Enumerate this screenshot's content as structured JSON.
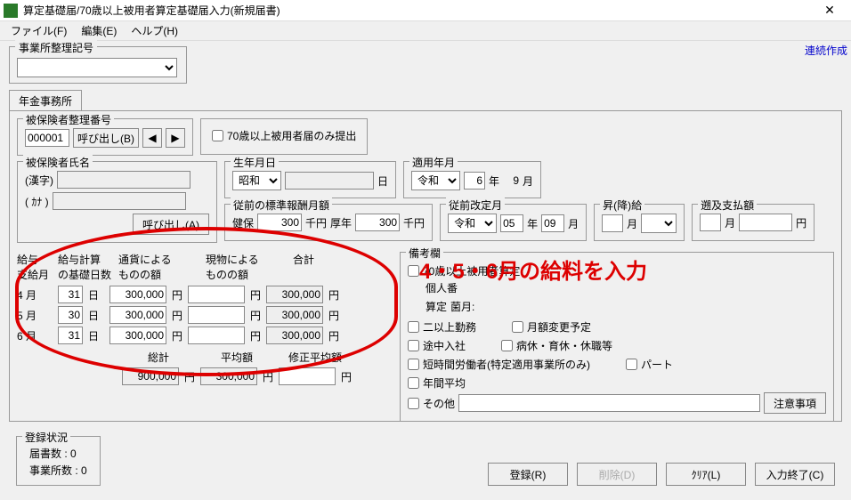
{
  "window": {
    "title": "算定基礎届/70歳以上被用者算定基礎届入力(新規届書)"
  },
  "menu": {
    "file": "ファイル(F)",
    "edit": "編集(E)",
    "help": "ヘルプ(H)"
  },
  "link": {
    "renzoku": "連続作成"
  },
  "office": {
    "label": "事業所整理記号"
  },
  "tab": {
    "nenkin": "年金事務所"
  },
  "hiho_no": {
    "label": "被保険者整理番号",
    "value": "000001",
    "call": "呼び出し(B)",
    "over70": "70歳以上被用者届のみ提出"
  },
  "name": {
    "label": "被保険者氏名",
    "kanji": "(漢字)",
    "kana": "( ｶﾅ )",
    "call": "呼び出し(A)"
  },
  "birth": {
    "label": "生年月日",
    "era": "昭和",
    "day_unit": "日"
  },
  "apply": {
    "label": "適用年月",
    "era": "令和",
    "y": "6",
    "y_unit": "年",
    "m": "9",
    "m_unit": "月"
  },
  "prev": {
    "label": "従前の標準報酬月額",
    "kenpo": "健保",
    "kenpo_v": "300",
    "kenpo_u": "千円",
    "kousei": "厚年",
    "kousei_v": "300",
    "kousei_u": "千円"
  },
  "prev_rev": {
    "label": "従前改定月",
    "era": "令和",
    "y": "05",
    "y_u": "年",
    "m": "09",
    "m_u": "月"
  },
  "shoukou": {
    "label": "昇(降)給",
    "m_u": "月"
  },
  "sokyuu": {
    "label": "遡及支払額",
    "unit": "円"
  },
  "salary": {
    "h1": "給与\n支給月",
    "h2": "給与計算\nの基礎日数",
    "h3": "通貨による\nものの額",
    "h4": "現物による\nものの額",
    "h5": "合計",
    "m4": "4 月",
    "m5": "5 月",
    "m6": "6 月",
    "d4": "31",
    "d5": "30",
    "d6": "31",
    "d_u": "日",
    "c4": "300,000",
    "c5": "300,000",
    "c6": "300,000",
    "t4": "300,000",
    "t5": "300,000",
    "t6": "300,000",
    "yen": "円",
    "soukei_l": "総計",
    "soukei": "900,000",
    "heikin_l": "平均額",
    "heikin": "300,000",
    "shusei_l": "修正平均額"
  },
  "biko": {
    "label": "備考欄",
    "c1": "70歳以上被用者算定",
    "kojin": "個人番",
    "santei": "算定",
    "kisoyou": "菌月:",
    "c2": "二以上勤務",
    "c2b": "月額変更予定",
    "c3": "途中入社",
    "c3b": "病休・育休・休職等",
    "c4": "短時間労働者(特定適用事業所のみ)",
    "c4b": "パート",
    "c5": "年間平均",
    "c6": "その他",
    "chuui": "注意事項"
  },
  "annotation": "4・5・6月の給料を入力",
  "status": {
    "label": "登録状況",
    "todoke": "届書数   :",
    "todoke_n": "0",
    "jigyo": "事業所数 :",
    "jigyo_n": "0"
  },
  "buttons": {
    "touroku": "登録(R)",
    "sakujo": "削除(D)",
    "clear": "ｸﾘｱ(L)",
    "end": "入力終了(C)"
  }
}
